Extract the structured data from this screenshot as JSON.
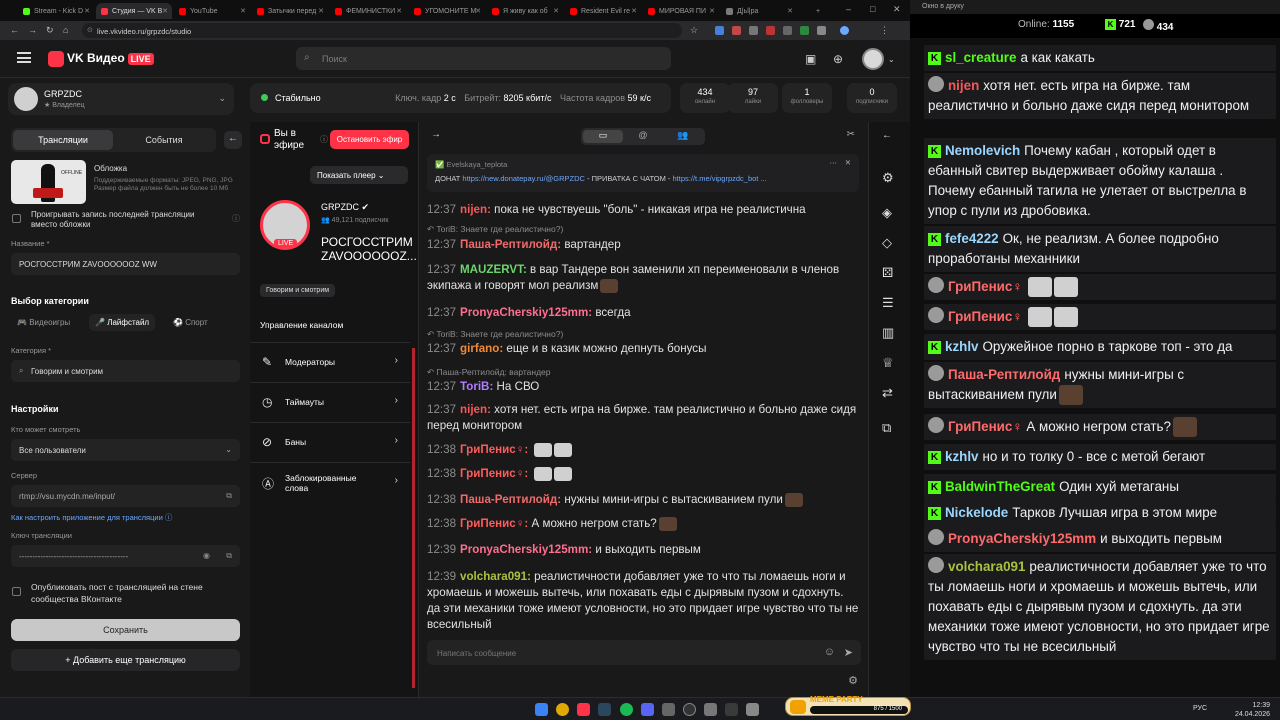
{
  "browser": {
    "tabs": [
      {
        "label": "Stream - Kick D",
        "color": "#53fc18"
      },
      {
        "label": "Студия — VK В",
        "color": "#ff3347"
      },
      {
        "label": "YouTube",
        "color": "#ff0000"
      },
      {
        "label": "Затычки перед",
        "color": "#ff0000"
      },
      {
        "label": "ФЕМИНИСТКИ",
        "color": "#ff0000"
      },
      {
        "label": "УГОМОНИТЕ М",
        "color": "#ff0000"
      },
      {
        "label": "Я живу как об",
        "color": "#ff0000"
      },
      {
        "label": "Resident Evil re",
        "color": "#ff0000"
      },
      {
        "label": "МИРОВАЯ ПИ",
        "color": "#ff0000"
      },
      {
        "label": "Д|ьl|ра",
        "color": "#7a7a7a"
      }
    ],
    "url": "live.vkvideo.ru/grpzdc/studio"
  },
  "header": {
    "brand": "VK Видео",
    "live_badge": "LIVE",
    "search_placeholder": "Поиск"
  },
  "account": {
    "name": "GRPZDC",
    "role": "Владелец"
  },
  "status": {
    "state": "Стабильно",
    "keyframe_label": "Ключ. кадр",
    "keyframe": "2 с",
    "bitrate_label": "Битрейт:",
    "bitrate": "8205 кбит/с",
    "fps_label": "Частота кадров",
    "fps": "59 к/с"
  },
  "metrics": [
    {
      "value": "434",
      "label": "онлайн"
    },
    {
      "value": "97",
      "label": "лайки"
    },
    {
      "value": "1",
      "label": "фолловеры"
    },
    {
      "value": "0",
      "label": "подписчики"
    }
  ],
  "left": {
    "tab_streams": "Трансляции",
    "tab_events": "События",
    "cover_title": "Обложка",
    "cover_hint": "Поддерживаемые форматы: JPEG, PNG, JPG Размер файла должен быть не более 10 Мб",
    "cover_offline": "OFFLINE",
    "play_last_label": "Проигрывать запись последней трансляции вместо обложки",
    "name_label": "Название *",
    "name_value": "РОСГОССТРИМ ZAVOOOOOOZ WW",
    "category_section": "Выбор категории",
    "cat_games": "Видеоигры",
    "cat_life": "Лайфстайл",
    "cat_sport": "Спорт",
    "category_label": "Категория *",
    "category_value": "Говорим и смотрим",
    "settings_section": "Настройки",
    "who_label": "Кто может смотреть",
    "who_value": "Все пользователи",
    "server_label": "Сервер",
    "server_value": "rtmp://vsu.mycdn.me/input/",
    "howto_link": "Как настроить приложение для трансляции",
    "key_label": "Ключ трансляции",
    "key_value": "-----------------------------------------",
    "publish_label": "Опубликовать пост с трансляцией на стене сообщества ВКонтакте",
    "save_button": "Сохранить",
    "add_button": "Добавить еще трансляцию"
  },
  "middle": {
    "on_air": "Вы в эфире",
    "stop_button": "Остановить эфир",
    "show_player": "Показать плеер",
    "channel_name": "GRPZDC",
    "channel_subs": "49,121 подписчик",
    "channel_live": "LIVE",
    "stream_title": "РОСГОССТРИМ ZAVOOOOOOZ...",
    "category_chip": "Говорим и смотрим",
    "mgmt_title": "Управление каналом",
    "mgmt_items": [
      "Модераторы",
      "Таймауты",
      "Баны",
      "Заблокированные слова"
    ]
  },
  "chat": {
    "pinned_user": "Evelskaya_teplota",
    "pinned_text_a": "ДОНАТ ",
    "pinned_link_a": "https://new.donatepay.ru/@GRPZDC",
    "pinned_text_b": " - ПРИВАТКА С ЧАТОМ - ",
    "pinned_link_b": "https://t.me/vipgrpzdc_bot ...",
    "input_placeholder": "Написать сообщение",
    "messages": [
      {
        "time": "12:37",
        "user": "nijen",
        "color": "#f05a5a",
        "text": "пока не чувствуешь \"боль\" - никакая игра не реалистична"
      },
      {
        "reply": "ToriB: Знаете где реалистично?)"
      },
      {
        "time": "12:37",
        "user": "Паша-Рептилойд",
        "color": "#ef6b6b",
        "text": "вартандер"
      },
      {
        "time": "12:37",
        "user": "MAUZERVT",
        "color": "#6dd46d",
        "text": "в вар Тандере вон заменили хп переименовали в членов экипажа и говорят мол реализм"
      },
      {
        "time": "12:37",
        "user": "PronyaCherskiy125mm",
        "color": "#ff6f8e",
        "text": "всегда"
      },
      {
        "reply": "ToriB: Знаете где реалистично?)"
      },
      {
        "time": "12:37",
        "user": "girfano",
        "color": "#f08a3c",
        "text": "еще и в казик можно депнуть бонусы"
      },
      {
        "reply": "Паша-Рептилойд: вартандер"
      },
      {
        "time": "12:37",
        "user": "ToriB",
        "color": "#b27cff",
        "text": "На СВО"
      },
      {
        "time": "12:37",
        "user": "nijen",
        "color": "#f05a5a",
        "text": "хотя нет. есть игра на бирже. там реалистично и больно даже сидя перед монитором"
      },
      {
        "time": "12:38",
        "user": "ГриПенис♀",
        "color": "#ff5b5b",
        "text": ""
      },
      {
        "time": "12:38",
        "user": "ГриПенис♀",
        "color": "#ff5b5b",
        "text": ""
      },
      {
        "time": "12:38",
        "user": "Паша-Рептилойд",
        "color": "#ef6b6b",
        "text": "нужны мини-игры с вытаскиванием пули"
      },
      {
        "time": "12:38",
        "user": "ГриПенис♀",
        "color": "#ff5b5b",
        "text": "А можно негром стать?"
      },
      {
        "time": "12:39",
        "user": "PronyaCherskiy125mm",
        "color": "#ff6f8e",
        "text": "и выходить первым"
      },
      {
        "time": "12:39",
        "user": "volchara091",
        "color": "#a9c23e",
        "text": "реалистичности добавляет уже то что ты ломаешь ноги и хромаешь и можешь вытечь, или похавать еды с дырявым пузом и сдохнуть. да эти механики тоже имеют условности, но это придает игре чувство что ты не всесильный"
      }
    ]
  },
  "overlay": {
    "window_title": "Окно в друку",
    "online_label": "Online:",
    "online_value": "1155",
    "kick_count": "721",
    "vk_count": "434",
    "messages": [
      {
        "src": "kick",
        "user": "sl_creature",
        "color": "#53fc18",
        "text": "а как какать"
      },
      {
        "src": "vk",
        "user": "nijen",
        "color": "#f05a5a",
        "text": "хотя нет. есть игра на бирже. там реалистично и больно даже сидя перед монитором"
      },
      {
        "src": "kick",
        "user": "Nemolevich",
        "color": "#9bd6ff",
        "text": "Почему кабан , который одет в ебанный свитер выдерживает обойму калаша . Почему ебанный тагила не улетает от выстрелла в упор с пули из дробовика."
      },
      {
        "src": "kick",
        "user": "fefe4222",
        "color": "#9bd6ff",
        "text": "Ок, не реализм. А более подробно проработаны механники"
      },
      {
        "src": "vk",
        "user": "ГриПенис♀",
        "color": "#ff6b6b",
        "text": ""
      },
      {
        "src": "vk",
        "user": "ГриПенис♀",
        "color": "#ff6b6b",
        "text": ""
      },
      {
        "src": "kick",
        "user": "kzhlv",
        "color": "#9bd6ff",
        "text": "Оружейное порно в таркове топ - это да"
      },
      {
        "src": "vk",
        "user": "Паша-Рептилойд",
        "color": "#ff6b6b",
        "text": "нужны мини-игры с вытаскиванием пули"
      },
      {
        "src": "vk",
        "user": "ГриПенис♀",
        "color": "#ff6b6b",
        "text": "А можно негром стать?"
      },
      {
        "src": "kick",
        "user": "kzhlv",
        "color": "#9bd6ff",
        "text": "но и то толку 0 - все с метой бегают"
      },
      {
        "src": "kick",
        "user": "BaldwinTheGreat",
        "color": "#53fc18",
        "text": "Один хуй метаганы"
      },
      {
        "src": "kick",
        "user": "Nickelode",
        "color": "#9bd6ff",
        "text": "Тарков Лучшая игра в этом мире"
      },
      {
        "src": "vk",
        "user": "PronyaCherskiy125mm",
        "color": "#ff6b6b",
        "text": "и выходить первым"
      },
      {
        "src": "vk",
        "user": "volchara091",
        "color": "#a9c23e",
        "text": "реалистичности добавляет уже то что ты ломаешь ноги и хромаешь и можешь вытечь, или похавать еды с дырявым пузом и сдохнуть. да эти механики тоже имеют условности, но это придает игре чувство что ты не всесильный"
      }
    ]
  },
  "taskbar": {
    "meme_title": "MEME PARTY",
    "meme_progress": "875 / 1500",
    "lang": "РУС",
    "time": "12:39",
    "date": "24.04.2026"
  }
}
